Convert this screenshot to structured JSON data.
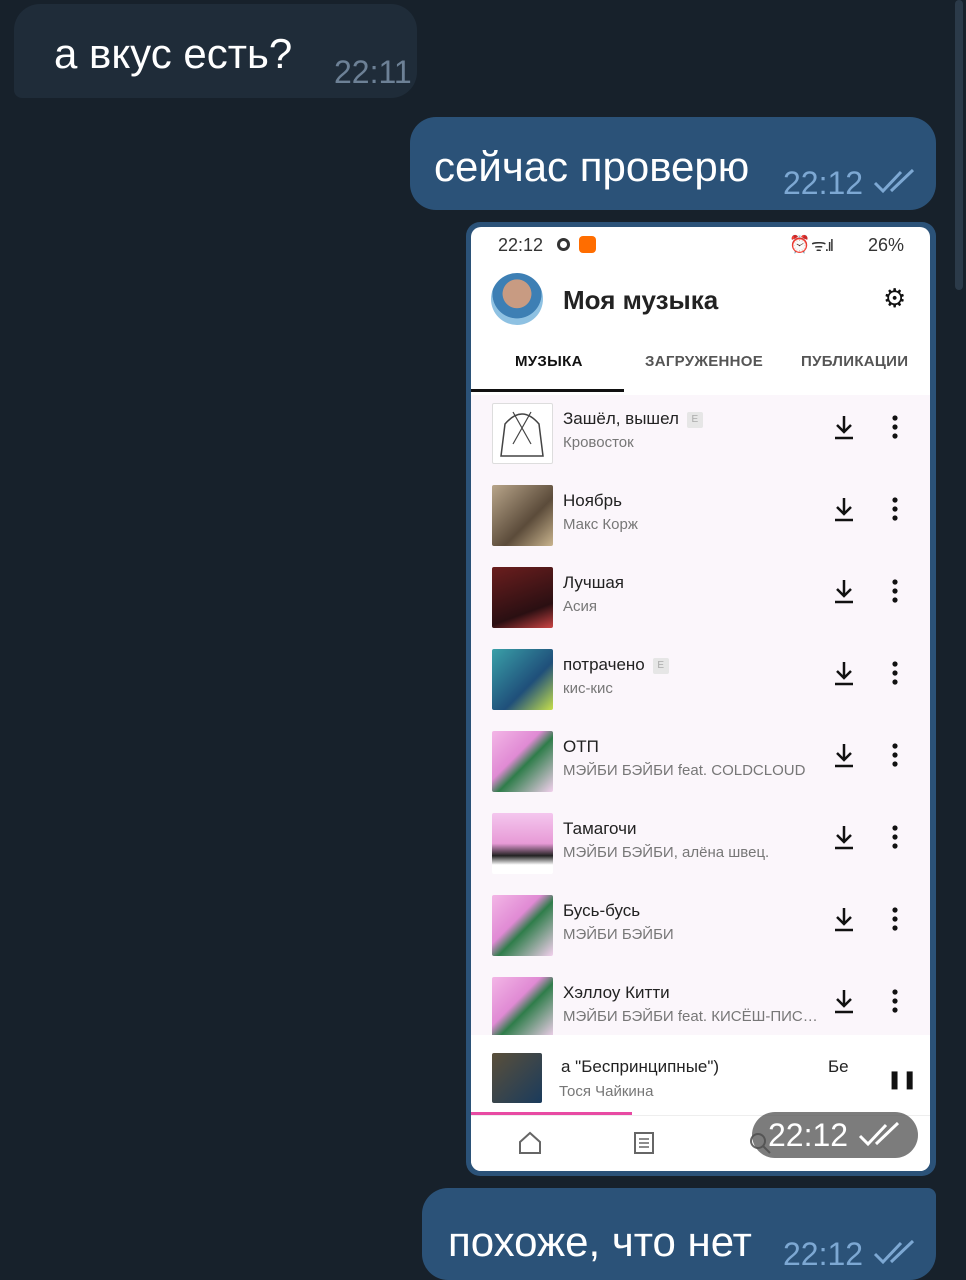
{
  "messages": [
    {
      "text": "а вкус есть?",
      "time": "22:11"
    },
    {
      "text": "сейчас проверю",
      "time": "22:12"
    },
    {
      "time": "22:12"
    },
    {
      "text": "похоже, что нет",
      "time": "22:12"
    }
  ],
  "phone": {
    "status": {
      "time": "22:12",
      "battery": "26%"
    },
    "title": "Моя музыка",
    "tabs": [
      "МУЗЫКА",
      "ЗАГРУЖЕННОЕ",
      "ПУБЛИКАЦИИ"
    ],
    "active_tab": "МУЗЫКА",
    "tracks": [
      {
        "title": "Зашёл, вышел",
        "artist": "Кровосток",
        "explicit": true
      },
      {
        "title": "Ноябрь",
        "artist": "Макс Корж",
        "explicit": false
      },
      {
        "title": "Лучшая",
        "artist": "Асия",
        "explicit": false
      },
      {
        "title": "потрачено",
        "artist": "кис-кис",
        "explicit": true
      },
      {
        "title": "ОТП",
        "artist": "МЭЙБИ БЭЙБИ feat. COLDCLOUD",
        "explicit": false
      },
      {
        "title": "Тамагочи",
        "artist": "МЭЙБИ БЭЙБИ, алёна швец.",
        "explicit": false
      },
      {
        "title": "Бусь-бусь",
        "artist": "МЭЙБИ БЭЙБИ",
        "explicit": false
      },
      {
        "title": "Хэллоу Китти",
        "artist": "МЭЙБИ БЭЙБИ feat. КИСЁШ-ПИС…",
        "explicit": false
      }
    ],
    "explicit_mark": "E",
    "now_playing": {
      "title": "а \"Беспринципные\")",
      "title_tail": "Бе",
      "artist": "Тося Чайкина",
      "progress": 0.35
    }
  },
  "colors": {
    "background": "#17212b",
    "bubble_out": "#2b5278",
    "bubble_in": "#1f2c39",
    "accent": "#e84aa3"
  }
}
